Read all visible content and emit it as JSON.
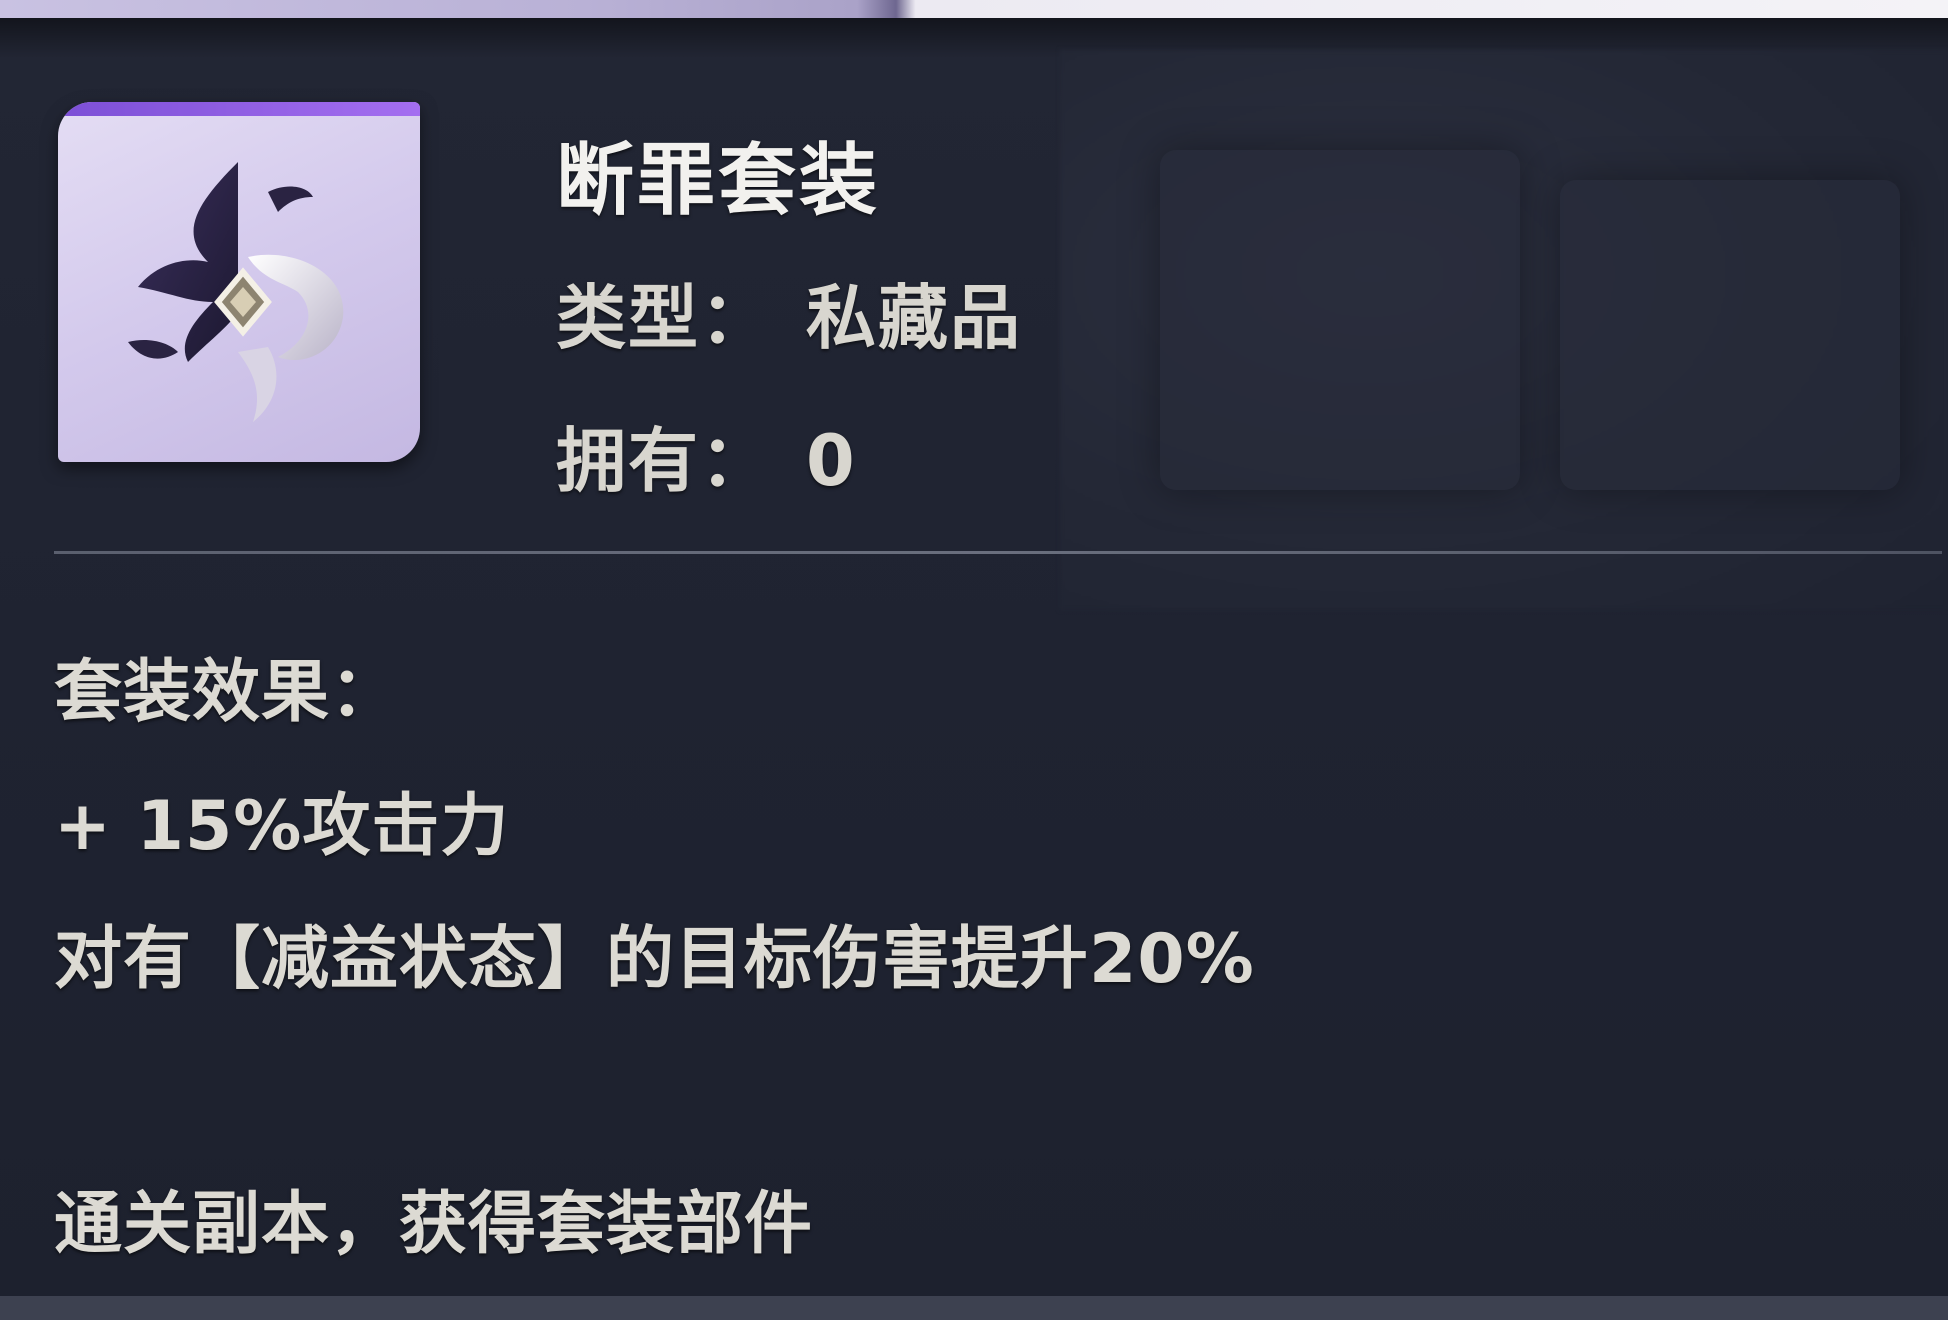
{
  "item": {
    "name": "断罪套装",
    "type_label": "类型：",
    "type_value": "私藏品",
    "owned_label": "拥有：",
    "owned_value": "0",
    "icon": "dark-crest-emblem-icon",
    "rarity_color": "#8a5ae0"
  },
  "set_effect": {
    "heading": "套装效果：",
    "effects": [
      "+ 15%攻击力",
      "对有【减益状态】的目标伤害提升20%"
    ]
  },
  "source": "通关副本，获得套装部件"
}
